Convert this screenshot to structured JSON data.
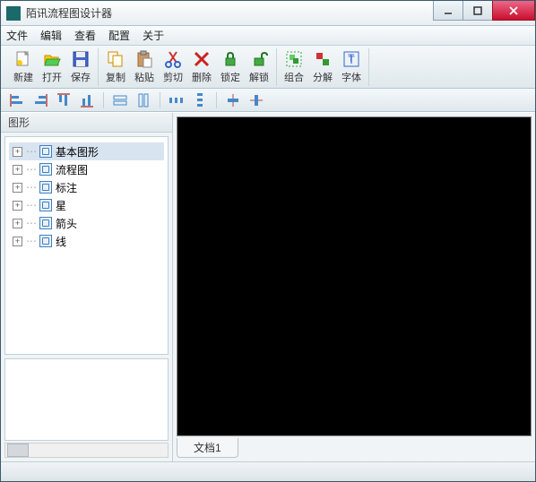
{
  "window": {
    "title": "陌讯流程图设计器"
  },
  "menubar": {
    "file": "文件",
    "edit": "编辑",
    "view": "查看",
    "config": "配置",
    "about": "关于"
  },
  "toolbar": {
    "new": "新建",
    "open": "打开",
    "save": "保存",
    "copy": "复制",
    "paste": "粘贴",
    "cut": "剪切",
    "delete": "删除",
    "lock": "锁定",
    "unlock": "解锁",
    "group": "组合",
    "ungroup": "分解",
    "font": "字体"
  },
  "sidebar": {
    "title": "图形",
    "items": [
      {
        "label": "基本图形"
      },
      {
        "label": "流程图"
      },
      {
        "label": "标注"
      },
      {
        "label": "星"
      },
      {
        "label": "箭头"
      },
      {
        "label": "线"
      }
    ]
  },
  "document": {
    "tab1": "文档1"
  }
}
